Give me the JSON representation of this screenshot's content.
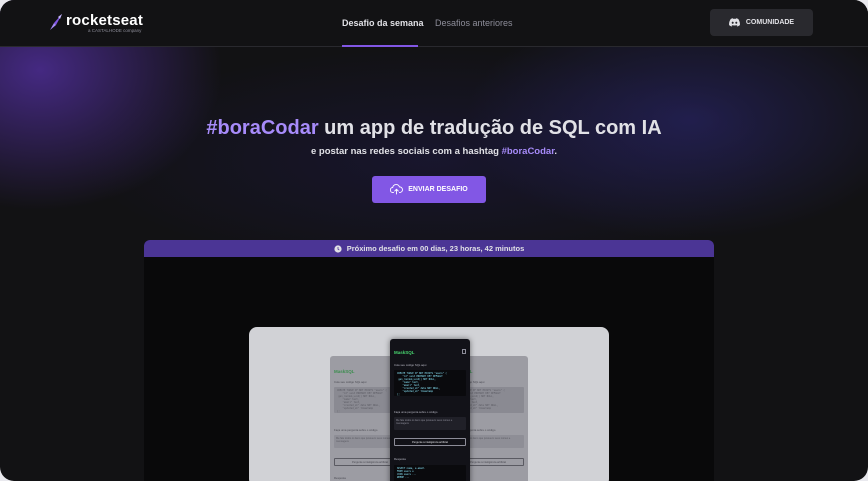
{
  "header": {
    "logo_text": "rocketseat",
    "logo_sub": "a CASTALHODE company",
    "nav": [
      {
        "label": "Desafio da semana",
        "active": true
      },
      {
        "label": "Desafios anteriores",
        "active": false
      }
    ],
    "community_label": "COMUNIDADE",
    "community_icon": "discord-icon"
  },
  "hero": {
    "title_accent": "#boraCodar",
    "title_rest": " um app de tradução de SQL com IA",
    "subtitle_text": "e postar nas redes sociais com a hashtag ",
    "subtitle_accent": "#boraCodar",
    "subtitle_end": ".",
    "cta_label": "ENVIAR DESAFIO",
    "cta_icon": "cloud-upload-icon"
  },
  "challenge": {
    "countdown": "Próximo desafio em 00 dias, 23 horas, 42 minutos",
    "countdown_icon": "clock-icon",
    "preview": {
      "app_title": "MaskSQL",
      "code_label": "Cole seu código SQL aqui",
      "code": "CREATE TABLE IF NOT EXISTS \"users\" (\n    \"id\" uuid PRIMARY KEY DEFAULT\n gen_random_uuid() NOT NULL,\n    \"name\" text,\n    \"email\" text,\n    \"created_at\" date NOT NULL,\n    \"updated_at\" timestamp\n);",
      "question_label": "Faça uma pergunta sobre o código",
      "question_placeholder": "Me fale todos os itens que possuem seus nomes e mensagens",
      "ask_button": "Pergunte à inteligência artificial",
      "response_label": "Resposta",
      "response_code": "SELECT name, e.email\nFROM users e\nJOIN users ...\nWHERE ..."
    }
  },
  "colors": {
    "background": "#121214",
    "accent": "#8257e5",
    "accent_text": "#a78bfa",
    "countdown_bar": "#4b3595",
    "card": "#09090a",
    "preview_bg": "#d1d2d6"
  }
}
